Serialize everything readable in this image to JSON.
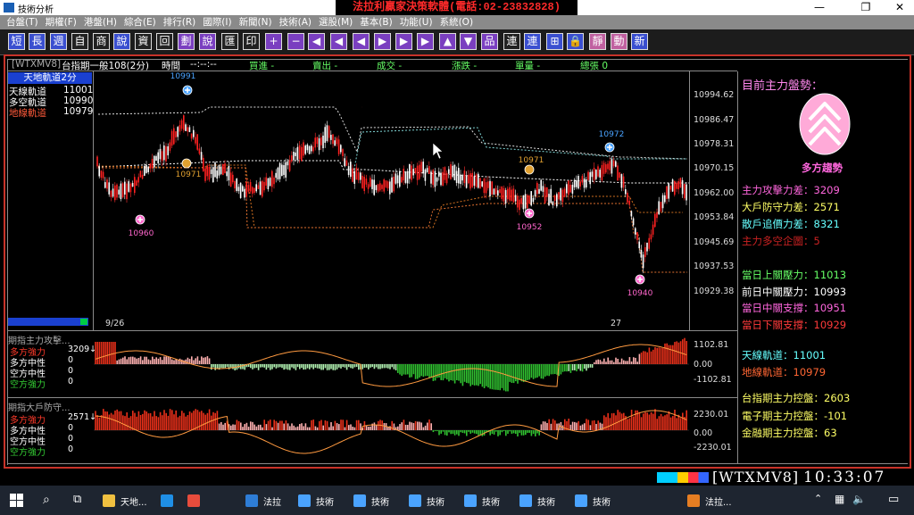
{
  "window": {
    "title": "技術分析",
    "brand": "法拉利贏家決策軟體(電話:02-23832828)"
  },
  "menu": [
    "台盤(T)",
    "期權(F)",
    "港盤(H)",
    "綜合(E)",
    "排行(R)",
    "國際(I)",
    "新聞(N)",
    "技術(A)",
    "選股(M)",
    "基本(B)",
    "功能(U)",
    "系統(O)"
  ],
  "toolbar": [
    "短",
    "長",
    "週",
    "自",
    "商",
    "說",
    "資",
    "回",
    "劃",
    "說",
    "匯",
    "印",
    "+",
    "−",
    "◀",
    "◀",
    "◀",
    "▶",
    "▶",
    "▶",
    "▲",
    "▼",
    "品",
    "連",
    "連",
    "⊞",
    "🔒",
    "靜",
    "動",
    "新"
  ],
  "header": {
    "symbol": "[WTXMV8]",
    "product": "台指期一般108(2分)",
    "time_label": "時間",
    "time_val": "--:--:--",
    "buy": "買進 -",
    "sell": "賣出 -",
    "deal": "成交 -",
    "change": "漲跌 -",
    "volume": "單量 -",
    "total": "總張 0"
  },
  "legend": {
    "title": "天地軌道2分",
    "rows": [
      {
        "label": "天線軌道",
        "value": "11001",
        "color": "#ffffff"
      },
      {
        "label": "多空軌道",
        "value": "10990",
        "color": "#ffffff"
      },
      {
        "label": "地線軌道",
        "value": "10979",
        "color": "#ff5a3a"
      }
    ]
  },
  "main_axis": [
    "10994.62",
    "10986.47",
    "10978.31",
    "10970.15",
    "10962.00",
    "10953.84",
    "10945.69",
    "10937.53",
    "10929.38"
  ],
  "markers": [
    {
      "label": "10991",
      "color": "#4aa3ff"
    },
    {
      "label": "10971",
      "color": "#e0a030"
    },
    {
      "label": "10960",
      "color": "#ff66cc"
    },
    {
      "label": "10971",
      "color": "#e0a030"
    },
    {
      "label": "10972",
      "color": "#4aa3ff"
    },
    {
      "label": "10952",
      "color": "#ff66cc"
    },
    {
      "label": "10940",
      "color": "#ff66cc"
    }
  ],
  "x_labels": [
    "9/26",
    "27"
  ],
  "panel1": {
    "title": "期指主力攻擊...",
    "rows": [
      {
        "label": "多方強力",
        "value": "3209↓",
        "color": "#ff3a2a"
      },
      {
        "label": "多方中性",
        "value": "0",
        "color": "#ffffff"
      },
      {
        "label": "空方中性",
        "value": "0",
        "color": "#ffffff"
      },
      {
        "label": "空方強力",
        "value": "0",
        "color": "#33cc33"
      }
    ],
    "axis": [
      "1102.81",
      "0.00",
      "-1102.81"
    ]
  },
  "panel2": {
    "title": "期指大戶防守...",
    "rows": [
      {
        "label": "多方強力",
        "value": "2571↓",
        "color": "#ff3a2a"
      },
      {
        "label": "多方中性",
        "value": "0",
        "color": "#ffffff"
      },
      {
        "label": "空方中性",
        "value": "0",
        "color": "#ffffff"
      },
      {
        "label": "空方強力",
        "value": "0",
        "color": "#33cc33"
      }
    ],
    "axis": [
      "2230.01",
      "0.00",
      "-2230.01"
    ]
  },
  "sidebar": {
    "title": "目前主力盤勢：",
    "trend": "多方趨勢",
    "lines": [
      {
        "text": "主力攻擊力差：3209",
        "color": "#ff66dd"
      },
      {
        "text": "大戶防守力差：2571",
        "color": "#ffff66"
      },
      {
        "text": "散戶追價力差：8321",
        "color": "#66ffff"
      },
      {
        "text": "主力多空企圖：5",
        "color": "#cc2222"
      },
      {
        "text": "當日上關壓力：11013",
        "color": "#66ff66"
      },
      {
        "text": "前日中關壓力：10993",
        "color": "#ffffff"
      },
      {
        "text": "當日中關支撐：10951",
        "color": "#ff66dd"
      },
      {
        "text": "當日下關支撐：10929",
        "color": "#ff3a3a"
      },
      {
        "text": "天線軌道：11001",
        "color": "#66ffff"
      },
      {
        "text": "地線軌道：10979",
        "color": "#ff6633"
      },
      {
        "text": "台指期主力控盤：2603",
        "color": "#ffff66"
      },
      {
        "text": "電子期主力控盤：-101",
        "color": "#ffff66"
      },
      {
        "text": "金融期主力控盤：63",
        "color": "#ffff66"
      }
    ]
  },
  "status": {
    "symbol": "[WTXMV8]",
    "time": "10:33:07"
  },
  "taskbar": [
    {
      "label": "天地...",
      "color": "#f0c040"
    },
    {
      "label": "",
      "color": "#1f8fe6"
    },
    {
      "label": "",
      "color": "#e74c3c"
    },
    {
      "label": "法拉",
      "color": "#2e7dd6"
    },
    {
      "label": "技術",
      "color": "#4aa3ff"
    },
    {
      "label": "技術",
      "color": "#4aa3ff"
    },
    {
      "label": "技術",
      "color": "#4aa3ff"
    },
    {
      "label": "技術",
      "color": "#4aa3ff"
    },
    {
      "label": "技術",
      "color": "#4aa3ff"
    },
    {
      "label": "技術",
      "color": "#4aa3ff"
    },
    {
      "label": "法拉...",
      "color": "#e67e22"
    }
  ]
}
